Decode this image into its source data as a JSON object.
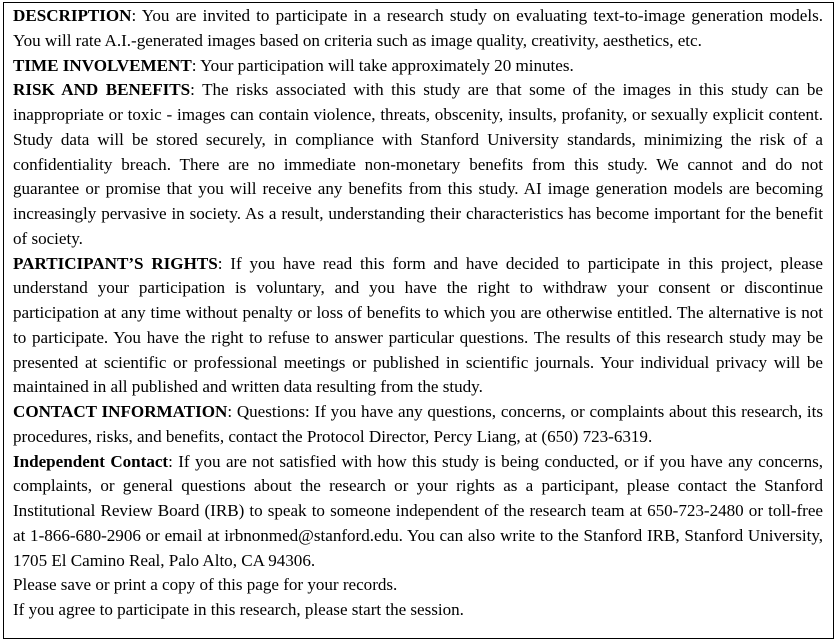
{
  "document": {
    "type": "research-study-consent-form",
    "border_color": "#000000",
    "text_color": "#000000",
    "background_color": "#ffffff",
    "sections": [
      {
        "id": "description",
        "heading": "DESCRIPTION",
        "separator": ": ",
        "body": "You are invited to participate in a research study on evaluating text-to-image generation models.  You will rate A.I.-generated images based on criteria such as image quality, creativity, aesthetics, etc."
      },
      {
        "id": "time-involvement",
        "heading": "TIME INVOLVEMENT",
        "separator": ": ",
        "body": "Your participation will take approximately 20 minutes."
      },
      {
        "id": "risk-and-benefits",
        "heading": "RISK AND BENEFITS",
        "separator": ": ",
        "body": "The risks associated with this study are that some of the images in this study can be inappropriate or toxic - images can contain violence, threats, obscenity, insults, profanity, or sexually explicit content. Study data will be stored securely, in compliance with Stanford University standards, minimizing the risk of a confidentiality breach.  There are no immediate non-monetary benefits from this study. We cannot and do not guarantee or promise that you will receive any benefits from this study.  AI image generation models are becoming increasingly pervasive in society.  As a result, understanding their characteristics has become important for the benefit of society."
      },
      {
        "id": "participants-rights",
        "heading": "PARTICIPANT’S RIGHTS",
        "separator": ": ",
        "body": "If you have read this form and have decided to participate in this project, please understand your participation is voluntary, and you have the right to withdraw your consent or discontinue participation at any time without penalty or loss of benefits to which you are otherwise entitled. The alternative is not to participate. You have the right to refuse to answer particular questions. The results of this research study may be presented at scientific or professional meetings or published in scientific journals.  Your individual privacy will be maintained in all published and written data resulting from the study."
      },
      {
        "id": "contact-information",
        "heading": "CONTACT INFORMATION",
        "separator": ": ",
        "body": "Questions: If you have any questions, concerns, or complaints about this research, its procedures, risks, and benefits, contact the Protocol Director, Percy Liang, at (650) 723-6319."
      },
      {
        "id": "independent-contact",
        "heading": "Independent Contact",
        "separator": ": ",
        "body": "If you are not satisfied with how this study is being conducted, or if you have any concerns, complaints, or general questions about the research or your rights as a participant, please contact the Stanford Institutional Review Board (IRB) to speak to someone independent of the research team at 650-723-2480 or toll-free at 1-866-680-2906 or email at irbnonmed@stanford.edu.  You can also write to the Stanford IRB, Stanford University, 1705 El Camino Real, Palo Alto, CA 94306."
      }
    ],
    "closing_lines": [
      "Please save or print a copy of this page for your records.",
      "If you agree to participate in this research, please start the session."
    ]
  }
}
